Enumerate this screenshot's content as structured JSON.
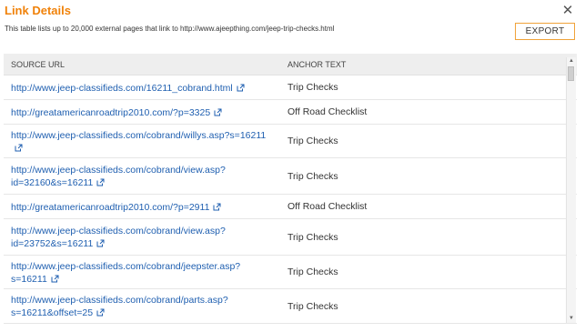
{
  "dialog": {
    "title": "Link Details",
    "description": "This table lists up to 20,000 external pages that link to http://www.ajeepthing.com/jeep-trip-checks.html",
    "export_label": "EXPORT",
    "close_glyph": "✕"
  },
  "table": {
    "headers": {
      "source": "SOURCE URL",
      "anchor": "ANCHOR TEXT"
    },
    "rows": [
      {
        "url": "http://www.jeep-classifieds.com/16211_cobrand.html",
        "anchor": "Trip Checks"
      },
      {
        "url": "http://greatamericanroadtrip2010.com/?p=3325",
        "anchor": "Off Road Checklist"
      },
      {
        "url": "http://www.jeep-classifieds.com/cobrand/willys.asp?s=16211",
        "anchor": "Trip Checks"
      },
      {
        "url": "http://www.jeep-classifieds.com/cobrand/view.asp?id=32160&s=16211",
        "anchor": "Trip Checks"
      },
      {
        "url": "http://greatamericanroadtrip2010.com/?p=2911",
        "anchor": "Off Road Checklist"
      },
      {
        "url": "http://www.jeep-classifieds.com/cobrand/view.asp?id=23752&s=16211",
        "anchor": "Trip Checks"
      },
      {
        "url": "http://www.jeep-classifieds.com/cobrand/jeepster.asp?s=16211",
        "anchor": "Trip Checks"
      },
      {
        "url": "http://www.jeep-classifieds.com/cobrand/parts.asp?s=16211&offset=25",
        "anchor": "Trip Checks"
      }
    ]
  },
  "scrollbar": {
    "up_glyph": "▲",
    "down_glyph": "▼"
  },
  "icons": {
    "external_link": "external-link-icon",
    "close": "close-icon"
  },
  "colors": {
    "title": "#f0820a",
    "link": "#1f5fb0",
    "export_border": "#f0a33a",
    "header_bg": "#eeeeee"
  }
}
